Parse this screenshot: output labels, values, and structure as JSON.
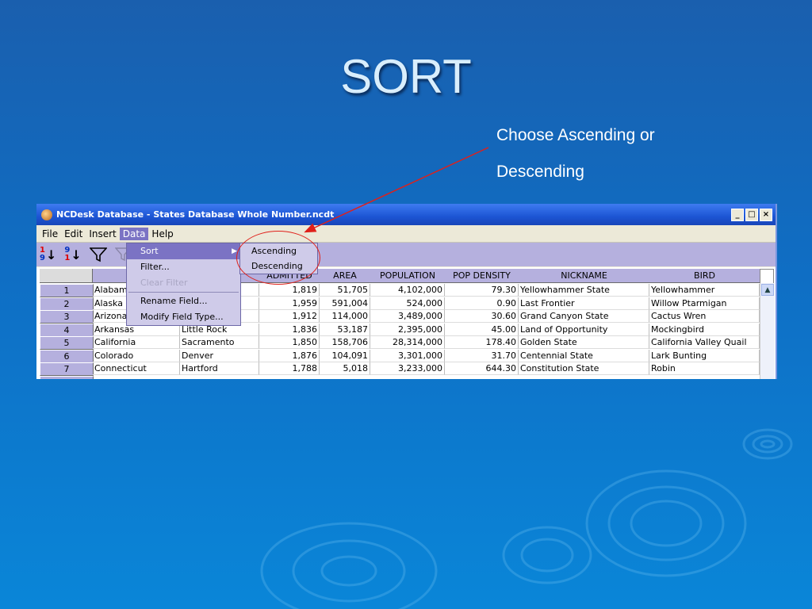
{
  "slide": {
    "title": "SORT",
    "callout_line1": "Choose Ascending or",
    "callout_line2": "Descending"
  },
  "window": {
    "title": "NCDesk Database - States Database Whole Number.ncdt",
    "btn_minimize": "_",
    "btn_maximize": "□",
    "btn_close": "×"
  },
  "menu": [
    "File",
    "Edit",
    "Insert",
    "Data",
    "Help"
  ],
  "toolbar": {
    "sort_asc_top": "1",
    "sort_asc_bottom": "9",
    "sort_desc_top": "9",
    "sort_desc_bottom": "1"
  },
  "columns": {
    "name_partial": "N",
    "admitted": "ADMITTED",
    "area": "AREA",
    "population": "POPULATION",
    "pop_density": "POP DENSITY",
    "nickname": "NICKNAME",
    "bird": "BIRD"
  },
  "rows": [
    {
      "num": "1",
      "name": "Alabam",
      "capital": "",
      "admitted": "1,819",
      "area": "51,705",
      "population": "4,102,000",
      "pop_density": "79.30",
      "nickname": "Yellowhammer State",
      "bird": "Yellowhammer"
    },
    {
      "num": "2",
      "name": "Alaska",
      "capital": "",
      "admitted": "1,959",
      "area": "591,004",
      "population": "524,000",
      "pop_density": "0.90",
      "nickname": "Last Frontier",
      "bird": "Willow Ptarmigan"
    },
    {
      "num": "3",
      "name": "Arizona",
      "capital": "",
      "admitted": "1,912",
      "area": "114,000",
      "population": "3,489,000",
      "pop_density": "30.60",
      "nickname": "Grand Canyon State",
      "bird": "Cactus Wren"
    },
    {
      "num": "4",
      "name": "Arkansas",
      "capital": "Little Rock",
      "admitted": "1,836",
      "area": "53,187",
      "population": "2,395,000",
      "pop_density": "45.00",
      "nickname": "Land of Opportunity",
      "bird": "Mockingbird"
    },
    {
      "num": "5",
      "name": "California",
      "capital": "Sacramento",
      "admitted": "1,850",
      "area": "158,706",
      "population": "28,314,000",
      "pop_density": "178.40",
      "nickname": "Golden State",
      "bird": "California Valley Quail"
    },
    {
      "num": "6",
      "name": "Colorado",
      "capital": "Denver",
      "admitted": "1,876",
      "area": "104,091",
      "population": "3,301,000",
      "pop_density": "31.70",
      "nickname": "Centennial State",
      "bird": "Lark Bunting"
    },
    {
      "num": "7",
      "name": "Connecticut",
      "capital": "Hartford",
      "admitted": "1,788",
      "area": "5,018",
      "population": "3,233,000",
      "pop_density": "644.30",
      "nickname": "Constitution State",
      "bird": "Robin"
    }
  ],
  "data_menu": {
    "sort": "Sort",
    "filter": "Filter...",
    "clear_filter": "Clear Filter",
    "rename_field": "Rename Field...",
    "modify_field_type": "Modify Field Type..."
  },
  "sort_submenu": {
    "ascending": "Ascending",
    "descending": "Descending"
  }
}
